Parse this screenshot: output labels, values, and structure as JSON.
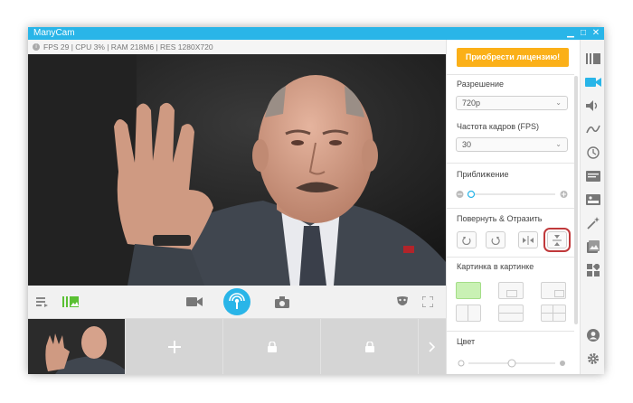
{
  "window": {
    "title": "ManyCam",
    "controls": {
      "minimize": "▁",
      "maximize": "□",
      "close": "✕"
    }
  },
  "statusbar": {
    "info_icon": "i",
    "text": "FPS 29 | CPU 3% | RAM 218M6 | RES 1280X720"
  },
  "panel": {
    "buy_button": "Приобрести лицензию!",
    "resolution": {
      "label": "Разрешение",
      "value": "720p"
    },
    "fps": {
      "label": "Частота кадров (FPS)",
      "value": "30"
    },
    "zoom": {
      "label": "Приближение",
      "level": 0.0
    },
    "rotate": {
      "label": "Повернуть & Отразить"
    },
    "pip": {
      "label": "Картинка в картинке"
    },
    "color": {
      "label": "Цвет"
    }
  },
  "colors": {
    "accent": "#29b5e8",
    "buy": "#fbb018",
    "highlight": "#c0393b",
    "pip_selected": "#c9f1b4"
  }
}
